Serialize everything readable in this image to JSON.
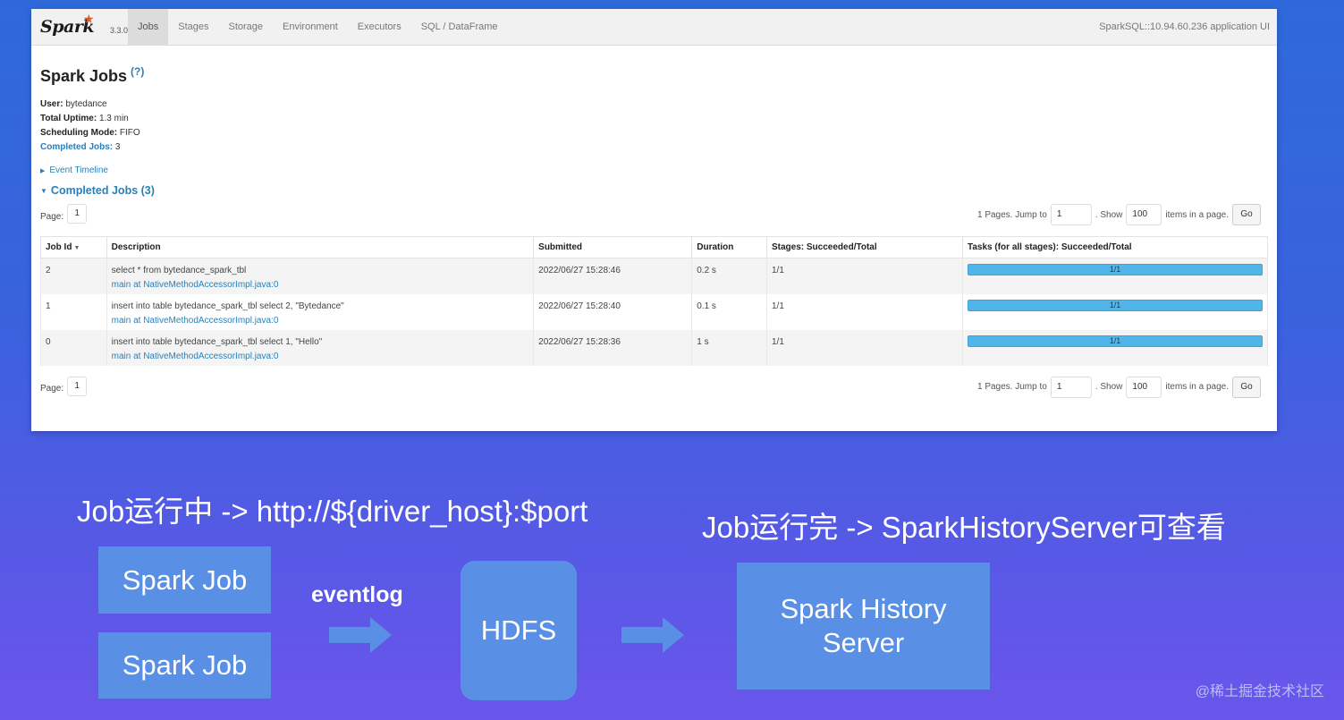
{
  "spark_ui": {
    "brand": {
      "logo_text": "Spark",
      "version": "3.3.0"
    },
    "tabs": [
      "Jobs",
      "Stages",
      "Storage",
      "Environment",
      "Executors",
      "SQL / DataFrame"
    ],
    "active_tab": "Jobs",
    "app_title": "SparkSQL::10.94.60.236 application UI",
    "page_title": "Spark Jobs",
    "help_link": "(?)",
    "summary": {
      "user_label": "User:",
      "user_value": "bytedance",
      "uptime_label": "Total Uptime:",
      "uptime_value": "1.3 min",
      "scheduling_label": "Scheduling Mode:",
      "scheduling_value": "FIFO",
      "completed_label": "Completed Jobs:",
      "completed_value": "3"
    },
    "event_timeline_label": "Event Timeline",
    "completed_section_label": "Completed Jobs (3)",
    "pager": {
      "page_label": "Page:",
      "page_value": "1",
      "pages_text": "1 Pages. Jump to",
      "jump_value": "1",
      "show_text": ". Show",
      "show_value": "100",
      "items_text": "items in a page.",
      "go_label": "Go"
    },
    "table": {
      "headers": [
        "Job Id",
        "Description",
        "Submitted",
        "Duration",
        "Stages: Succeeded/Total",
        "Tasks (for all stages): Succeeded/Total"
      ],
      "rows": [
        {
          "id": "2",
          "desc": "select * from bytedance_spark_tbl",
          "desc_sub": "main at NativeMethodAccessorImpl.java:0",
          "submitted": "2022/06/27 15:28:46",
          "duration": "0.2 s",
          "stages": "1/1",
          "tasks": "1/1",
          "tasks_fraction": 1.0
        },
        {
          "id": "1",
          "desc": "insert into table bytedance_spark_tbl select 2, \"Bytedance\"",
          "desc_sub": "main at NativeMethodAccessorImpl.java:0",
          "submitted": "2022/06/27 15:28:40",
          "duration": "0.1 s",
          "stages": "1/1",
          "tasks": "1/1",
          "tasks_fraction": 1.0
        },
        {
          "id": "0",
          "desc": "insert into table bytedance_spark_tbl select 1, \"Hello\"",
          "desc_sub": "main at NativeMethodAccessorImpl.java:0",
          "submitted": "2022/06/27 15:28:36",
          "duration": "1 s",
          "stages": "1/1",
          "tasks": "1/1",
          "tasks_fraction": 1.0
        }
      ]
    }
  },
  "diagram": {
    "running_caption": "Job运行中 -> http://${driver_host}:$port",
    "finished_caption": "Job运行完 -> SparkHistoryServer可查看",
    "job_box_1": "Spark Job",
    "job_box_2": "Spark Job",
    "eventlog_label": "eventlog",
    "hdfs_label": "HDFS",
    "history_server_line1": "Spark History",
    "history_server_line2": "Server"
  },
  "watermark": "@稀土掘金技术社区"
}
